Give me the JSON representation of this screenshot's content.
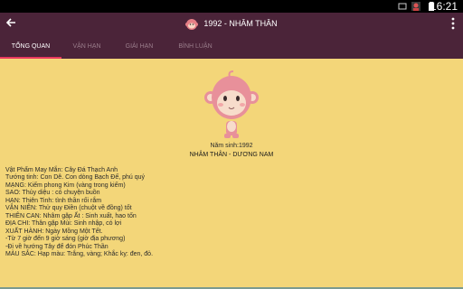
{
  "status": {
    "time": "16:21"
  },
  "appbar": {
    "title": "1992 - NHÂM THÂN"
  },
  "tabs": [
    {
      "label": "TỔNG QUAN"
    },
    {
      "label": "VẬN HẠN"
    },
    {
      "label": "GIẢI HẠN"
    },
    {
      "label": "BÌNH LUẬN"
    }
  ],
  "profile": {
    "birth_year_text": "Năm sinh:1992",
    "zodiac_text": "NHÂM THÂN - DƯƠNG NAM"
  },
  "details": [
    "Vật Phẩm May Mắn: Cây Đá Thạch Anh",
    "Tướng tinh: Con Dê. Con dòng Bạch Đế, phú quý",
    "MẠNG: Kiếm phong Kim (vàng trong kiếm)",
    "SAO: Thủy diệu : có chuyện buồn",
    "HẠN: Thiên Tinh: tình thần rối rắm",
    "VẬN NIÊN: Thử quy Điền (chuột về đồng) tốt",
    "THIÊN CAN: Nhâm gặp Ất : Sinh xuất, hao tốn",
    "ĐỊA CHI: Thân gặp Mùi: Sinh nhập, có lợi",
    "XUẤT HÀNH: Ngày Mồng Một Tết.",
    " -Từ 7 giờ đến 9 giờ sáng (giờ địa phương)",
    " -Đi về hướng Tây để đón Phúc Thần",
    "MÀU SẮC: Hạp màu: Trắng, vàng; Khắc kỵ: đen, đỏ."
  ]
}
